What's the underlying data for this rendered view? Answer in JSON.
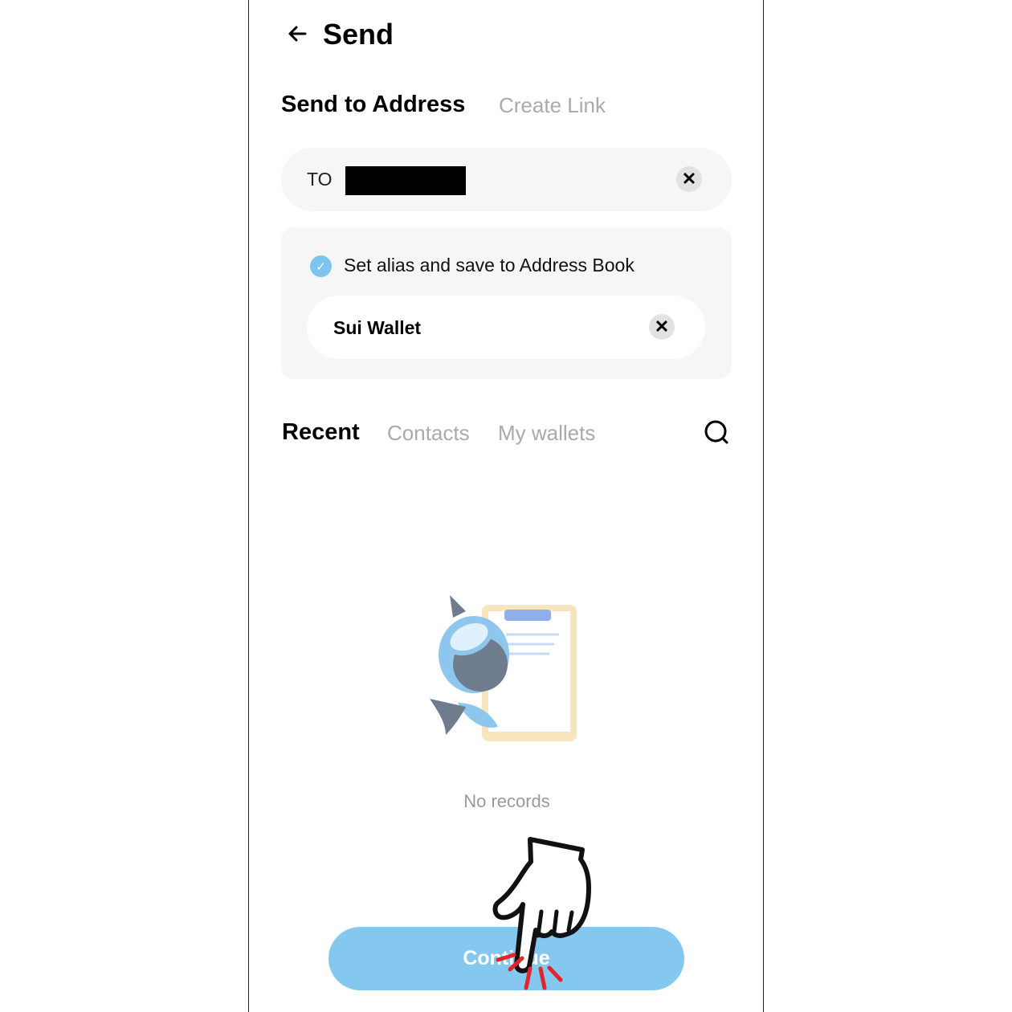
{
  "header": {
    "title": "Send",
    "back_icon": "arrow-left-icon"
  },
  "send_tabs": [
    {
      "label": "Send to Address",
      "active": true
    },
    {
      "label": "Create Link",
      "active": false
    }
  ],
  "to_field": {
    "label": "TO",
    "value_redacted": true
  },
  "alias": {
    "checkbox_label": "Set alias and save to Address Book",
    "checked": true,
    "value": "Sui Wallet"
  },
  "list_tabs": [
    {
      "label": "Recent",
      "active": true
    },
    {
      "label": "Contacts",
      "active": false
    },
    {
      "label": "My wallets",
      "active": false
    }
  ],
  "empty_state": {
    "text": "No records"
  },
  "continue_label": "Continue",
  "colors": {
    "accent": "#84c8f0",
    "check": "#7dc5ef",
    "field_bg": "#f6f6f6"
  }
}
